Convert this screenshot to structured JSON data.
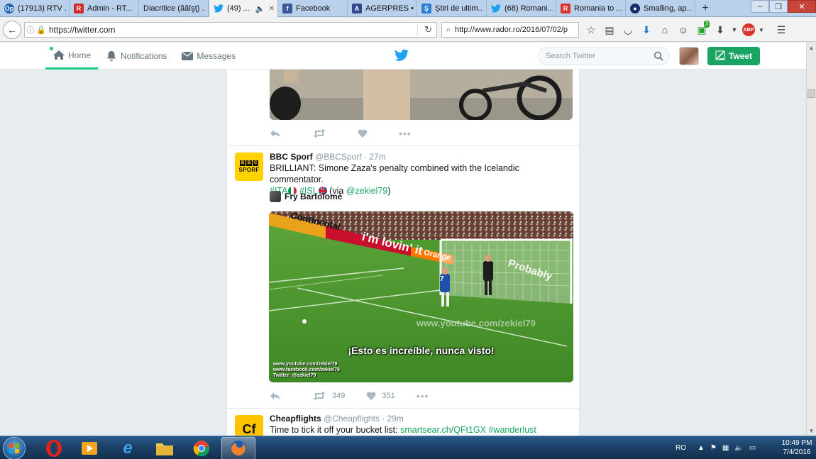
{
  "browser": {
    "tabs": [
      {
        "label": "(17913) RTV ...",
        "fav": "Op",
        "color": "#1e63b5"
      },
      {
        "label": "Admin - RT...",
        "fav": "R",
        "color": "#d32a2a"
      },
      {
        "label": "Diacritice (ăâîşţ) ...",
        "fav": "",
        "color": "#b9d1ea"
      },
      {
        "label": "(49) ...",
        "fav": "t",
        "color": "#1da1f2",
        "active": true
      },
      {
        "label": "Facebook",
        "fav": "f",
        "color": "#3b5998"
      },
      {
        "label": "AGERPRES • ...",
        "fav": "A",
        "color": "#2f4a8a"
      },
      {
        "label": "Știri de ultim...",
        "fav": "Ş",
        "color": "#2b7fd3"
      },
      {
        "label": "(68) Romani...",
        "fav": "t",
        "color": "#1da1f2"
      },
      {
        "label": "Romania to ...",
        "fav": "R",
        "color": "#e02f2f"
      },
      {
        "label": "Smalling, ap...",
        "fav": "●",
        "color": "#152f6e"
      }
    ],
    "new_tab": "+",
    "url": "https://twitter.com",
    "search_text": "http://www.rador.ro/2016/07/02/p",
    "downloads_badge": "3",
    "abp_label": "ABP",
    "window_controls": {
      "minimize": "–",
      "restore": "❐",
      "close": "✕"
    }
  },
  "twitter": {
    "nav": {
      "home": "Home",
      "notifications": "Notifications",
      "messages": "Messages"
    },
    "search_placeholder": "Search Twitter",
    "tweet_button": "Tweet",
    "accent": "#19a463"
  },
  "tweets": [
    {
      "media_only": true,
      "replies": "",
      "retweets": "",
      "likes": ""
    },
    {
      "name": "BBC Sporf",
      "handle": "@BBCSporf",
      "time": "· 27m",
      "avatar_boxes": [
        "B",
        "B",
        "C"
      ],
      "avatar_word": "SPORF",
      "text": "BRILLIANT: Simone Zaza's penalty combined with the Icelandic commentator.",
      "tag_ita": "#ITA",
      "tag_isl": "#ISL",
      "via_prefix": "(via ",
      "via_handle": "@zekiel79",
      "via_suffix": ")",
      "retweeter": "Fry Bartolomé",
      "video": {
        "subtitle": "¡Esto es increíble, nunca visto!",
        "watermark": "www.youtube.com/zekiel79",
        "credit_1": "www.youtube.com/zekiel79",
        "credit_2": "www.facebook.com/zekiel79",
        "credit_3": "Twitter: @zekiel79",
        "ad_text": "i'm lovin' it",
        "board_text": "Continental",
        "board_text_2": "Orange",
        "net_text": "Probably",
        "player_number": "7"
      },
      "retweets": "349",
      "likes": "351"
    },
    {
      "name": "Cheapflights",
      "handle": "@Cheapflights",
      "time": "· 29m",
      "avatar_text": "Cf",
      "text": "Time to tick it off your bucket list:",
      "link": "smartsear.ch/QFt1GX",
      "hashtag": "#wanderlust"
    }
  ],
  "taskbar": {
    "language": "RO",
    "time": "10:49 PM",
    "date": "7/4/2016"
  }
}
